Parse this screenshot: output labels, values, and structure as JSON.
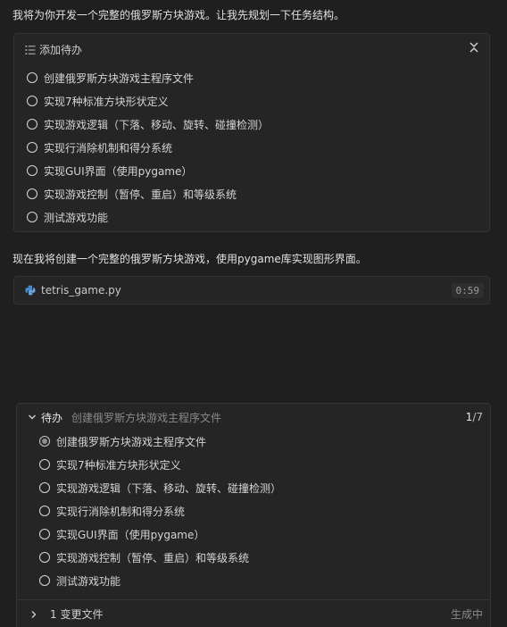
{
  "intro_message": "我将为你开发一个完整的俄罗斯方块游戏。让我先规划一下任务结构。",
  "todo_card": {
    "title": "添加待办",
    "items": [
      "创建俄罗斯方块游戏主程序文件",
      "实现7种标准方块形状定义",
      "实现游戏逻辑（下落、移动、旋转、碰撞检测）",
      "实现行消除机制和得分系统",
      "实现GUI界面（使用pygame）",
      "实现游戏控制（暂停、重启）和等级系统",
      "测试游戏功能"
    ]
  },
  "second_message": "现在我将创建一个完整的俄罗斯方块游戏，使用pygame库实现图形界面。",
  "file_card": {
    "icon": "python-icon",
    "file_name": "tetris_game.py",
    "time": "0:59"
  },
  "todo_panel": {
    "title": "待办",
    "current_task": "创建俄罗斯方块游戏主程序文件",
    "progress_current": "1",
    "progress_total": "/7",
    "items": [
      "创建俄罗斯方块游戏主程序文件",
      "实现7种标准方块形状定义",
      "实现游戏逻辑（下落、移动、旋转、碰撞检测）",
      "实现行消除机制和得分系统",
      "实现GUI界面（使用pygame）",
      "实现游戏控制（暂停、重启）和等级系统",
      "测试游戏功能"
    ],
    "footer_label": "1 变更文件",
    "footer_status": "生成中"
  }
}
